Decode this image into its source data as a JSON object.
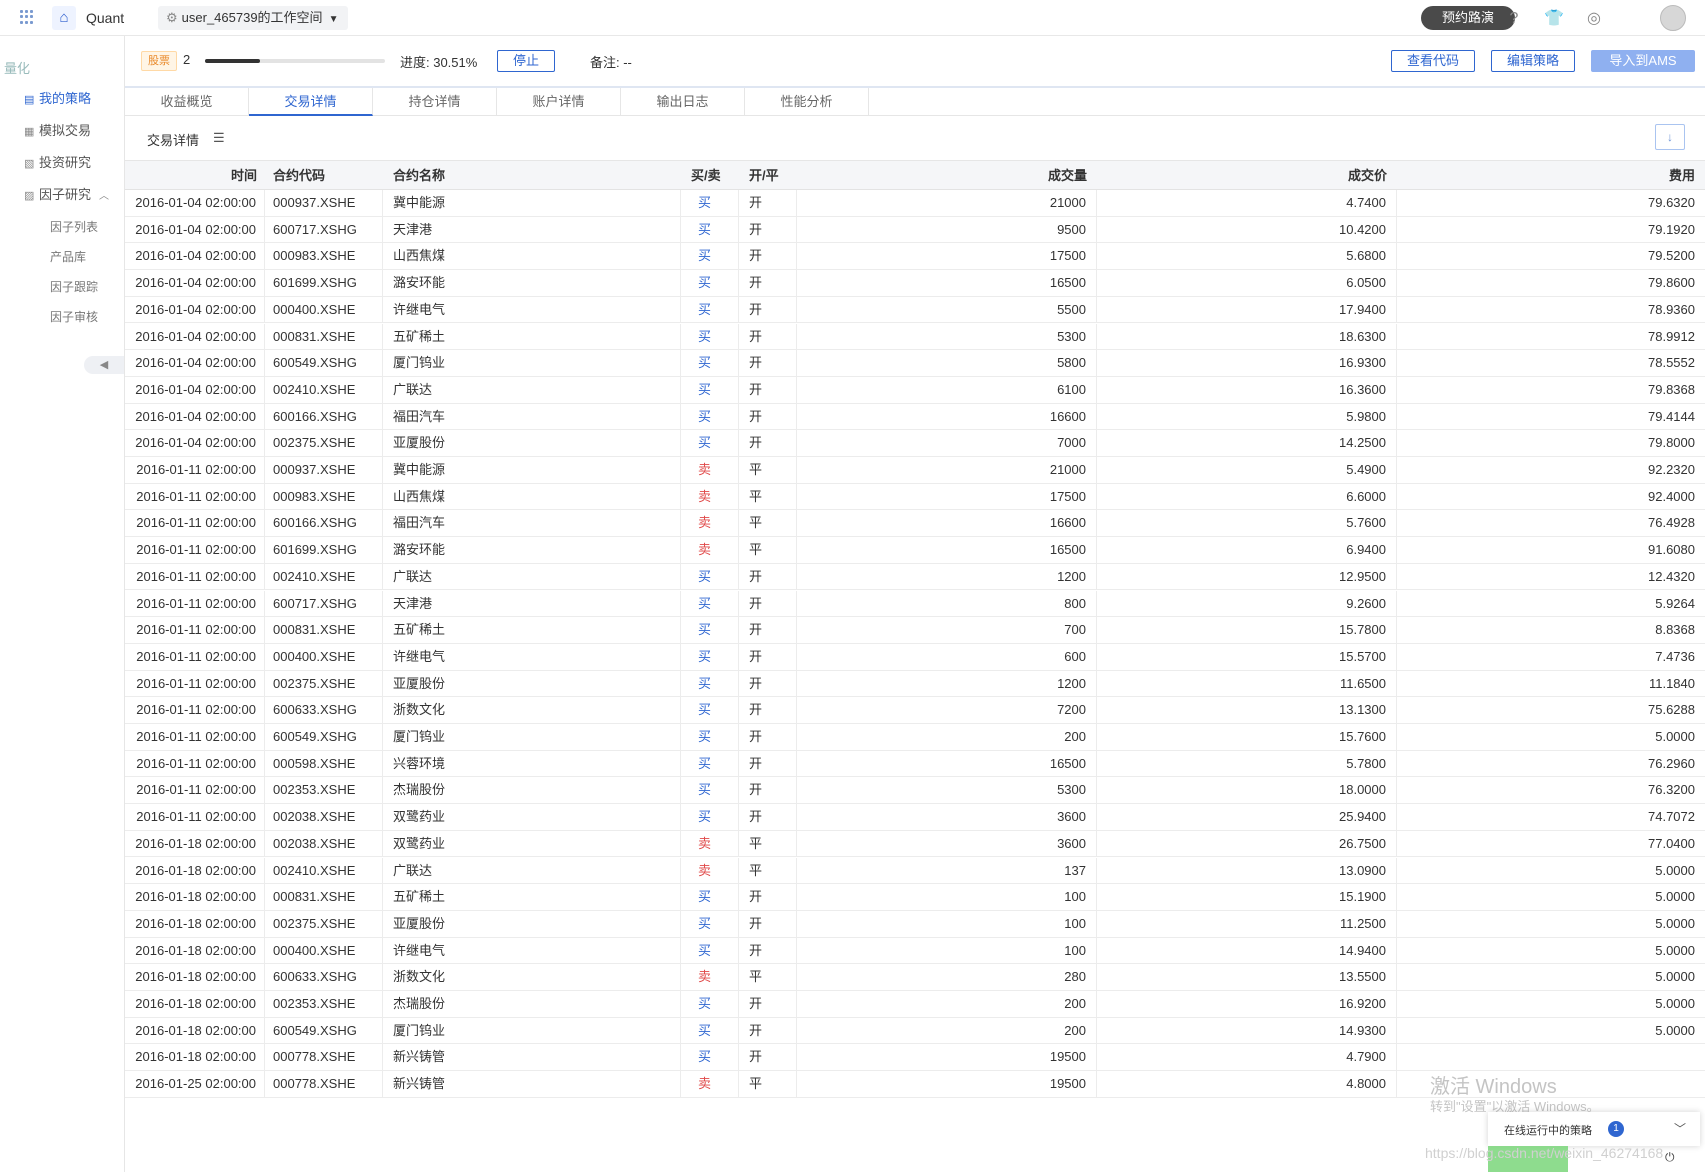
{
  "topbar": {
    "app_name": "Quant",
    "workspace": "user_465739的工作空间",
    "roadshow": "预约路演"
  },
  "sidebar": {
    "title": "量化",
    "items": [
      {
        "label": "我的策略",
        "active": true
      },
      {
        "label": "模拟交易"
      },
      {
        "label": "投资研究"
      },
      {
        "label": "因子研究"
      }
    ],
    "subitems": [
      "因子列表",
      "产品库",
      "因子跟踪",
      "因子审核"
    ]
  },
  "info": {
    "tag": "股票",
    "count": "2",
    "progress_value": 0.3051,
    "progress_text": "进度: 30.51%",
    "stop": "停止",
    "remark": "备注: --",
    "view_code": "查看代码",
    "edit_strategy": "编辑策略",
    "import_ams": "导入到AMS"
  },
  "tabs": [
    "收益概览",
    "交易详情",
    "持仓详情",
    "账户详情",
    "输出日志",
    "性能分析"
  ],
  "section": {
    "title": "交易详情"
  },
  "table": {
    "headers": [
      "时间",
      "合约代码",
      "合约名称",
      "买/卖",
      "开/平",
      "成交量",
      "成交价",
      "费用"
    ],
    "rows": [
      [
        "2016-01-04 02:00:00",
        "000937.XSHE",
        "冀中能源",
        "买",
        "开",
        "21000",
        "4.7400",
        "79.6320"
      ],
      [
        "2016-01-04 02:00:00",
        "600717.XSHG",
        "天津港",
        "买",
        "开",
        "9500",
        "10.4200",
        "79.1920"
      ],
      [
        "2016-01-04 02:00:00",
        "000983.XSHE",
        "山西焦煤",
        "买",
        "开",
        "17500",
        "5.6800",
        "79.5200"
      ],
      [
        "2016-01-04 02:00:00",
        "601699.XSHG",
        "潞安环能",
        "买",
        "开",
        "16500",
        "6.0500",
        "79.8600"
      ],
      [
        "2016-01-04 02:00:00",
        "000400.XSHE",
        "许继电气",
        "买",
        "开",
        "5500",
        "17.9400",
        "78.9360"
      ],
      [
        "2016-01-04 02:00:00",
        "000831.XSHE",
        "五矿稀土",
        "买",
        "开",
        "5300",
        "18.6300",
        "78.9912"
      ],
      [
        "2016-01-04 02:00:00",
        "600549.XSHG",
        "厦门钨业",
        "买",
        "开",
        "5800",
        "16.9300",
        "78.5552"
      ],
      [
        "2016-01-04 02:00:00",
        "002410.XSHE",
        "广联达",
        "买",
        "开",
        "6100",
        "16.3600",
        "79.8368"
      ],
      [
        "2016-01-04 02:00:00",
        "600166.XSHG",
        "福田汽车",
        "买",
        "开",
        "16600",
        "5.9800",
        "79.4144"
      ],
      [
        "2016-01-04 02:00:00",
        "002375.XSHE",
        "亚厦股份",
        "买",
        "开",
        "7000",
        "14.2500",
        "79.8000"
      ],
      [
        "2016-01-11 02:00:00",
        "000937.XSHE",
        "冀中能源",
        "卖",
        "平",
        "21000",
        "5.4900",
        "92.2320"
      ],
      [
        "2016-01-11 02:00:00",
        "000983.XSHE",
        "山西焦煤",
        "卖",
        "平",
        "17500",
        "6.6000",
        "92.4000"
      ],
      [
        "2016-01-11 02:00:00",
        "600166.XSHG",
        "福田汽车",
        "卖",
        "平",
        "16600",
        "5.7600",
        "76.4928"
      ],
      [
        "2016-01-11 02:00:00",
        "601699.XSHG",
        "潞安环能",
        "卖",
        "平",
        "16500",
        "6.9400",
        "91.6080"
      ],
      [
        "2016-01-11 02:00:00",
        "002410.XSHE",
        "广联达",
        "买",
        "开",
        "1200",
        "12.9500",
        "12.4320"
      ],
      [
        "2016-01-11 02:00:00",
        "600717.XSHG",
        "天津港",
        "买",
        "开",
        "800",
        "9.2600",
        "5.9264"
      ],
      [
        "2016-01-11 02:00:00",
        "000831.XSHE",
        "五矿稀土",
        "买",
        "开",
        "700",
        "15.7800",
        "8.8368"
      ],
      [
        "2016-01-11 02:00:00",
        "000400.XSHE",
        "许继电气",
        "买",
        "开",
        "600",
        "15.5700",
        "7.4736"
      ],
      [
        "2016-01-11 02:00:00",
        "002375.XSHE",
        "亚厦股份",
        "买",
        "开",
        "1200",
        "11.6500",
        "11.1840"
      ],
      [
        "2016-01-11 02:00:00",
        "600633.XSHG",
        "浙数文化",
        "买",
        "开",
        "7200",
        "13.1300",
        "75.6288"
      ],
      [
        "2016-01-11 02:00:00",
        "600549.XSHG",
        "厦门钨业",
        "买",
        "开",
        "200",
        "15.7600",
        "5.0000"
      ],
      [
        "2016-01-11 02:00:00",
        "000598.XSHE",
        "兴蓉环境",
        "买",
        "开",
        "16500",
        "5.7800",
        "76.2960"
      ],
      [
        "2016-01-11 02:00:00",
        "002353.XSHE",
        "杰瑞股份",
        "买",
        "开",
        "5300",
        "18.0000",
        "76.3200"
      ],
      [
        "2016-01-11 02:00:00",
        "002038.XSHE",
        "双鹭药业",
        "买",
        "开",
        "3600",
        "25.9400",
        "74.7072"
      ],
      [
        "2016-01-18 02:00:00",
        "002038.XSHE",
        "双鹭药业",
        "卖",
        "平",
        "3600",
        "26.7500",
        "77.0400"
      ],
      [
        "2016-01-18 02:00:00",
        "002410.XSHE",
        "广联达",
        "卖",
        "平",
        "137",
        "13.0900",
        "5.0000"
      ],
      [
        "2016-01-18 02:00:00",
        "000831.XSHE",
        "五矿稀土",
        "买",
        "开",
        "100",
        "15.1900",
        "5.0000"
      ],
      [
        "2016-01-18 02:00:00",
        "002375.XSHE",
        "亚厦股份",
        "买",
        "开",
        "100",
        "11.2500",
        "5.0000"
      ],
      [
        "2016-01-18 02:00:00",
        "000400.XSHE",
        "许继电气",
        "买",
        "开",
        "100",
        "14.9400",
        "5.0000"
      ],
      [
        "2016-01-18 02:00:00",
        "600633.XSHG",
        "浙数文化",
        "卖",
        "平",
        "280",
        "13.5500",
        "5.0000"
      ],
      [
        "2016-01-18 02:00:00",
        "002353.XSHE",
        "杰瑞股份",
        "买",
        "开",
        "200",
        "16.9200",
        "5.0000"
      ],
      [
        "2016-01-18 02:00:00",
        "600549.XSHG",
        "厦门钨业",
        "买",
        "开",
        "200",
        "14.9300",
        "5.0000"
      ],
      [
        "2016-01-18 02:00:00",
        "000778.XSHE",
        "新兴铸管",
        "买",
        "开",
        "19500",
        "4.7900",
        ""
      ],
      [
        "2016-01-25 02:00:00",
        "000778.XSHE",
        "新兴铸管",
        "卖",
        "平",
        "19500",
        "4.8000",
        ""
      ]
    ]
  },
  "overlay": {
    "windows_title": "激活 Windows",
    "windows_sub": "转到\"设置\"以激活 Windows。",
    "running_label": "在线运行中的策略",
    "running_count": "1",
    "csdn": "https://blog.csdn.net/weixin_46274168"
  },
  "colors": {
    "accent": "#2f66d0",
    "buy": "#2f66d0",
    "sell": "#e04a4a"
  }
}
